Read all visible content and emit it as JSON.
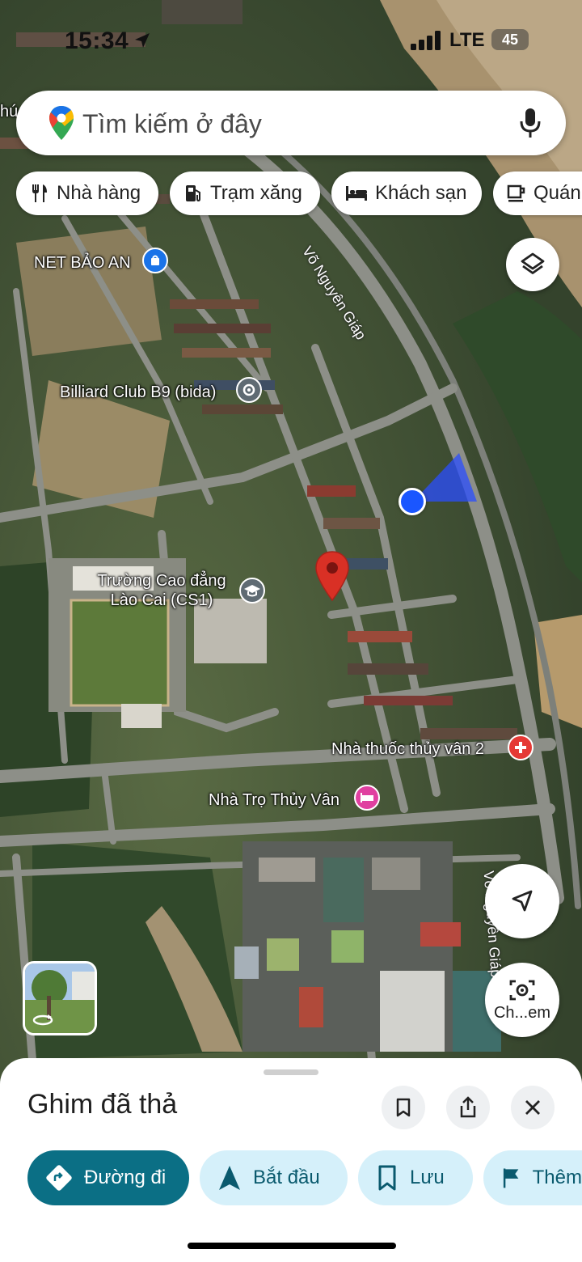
{
  "status_bar": {
    "time": "15:34",
    "network": "LTE",
    "battery": "45"
  },
  "search": {
    "placeholder": "Tìm kiếm ở đây"
  },
  "chips": [
    {
      "label": "Nhà hàng",
      "icon": "fork-knife-icon"
    },
    {
      "label": "Trạm xăng",
      "icon": "gas-pump-icon"
    },
    {
      "label": "Khách sạn",
      "icon": "bed-icon"
    },
    {
      "label": "Quán",
      "icon": "coffee-cup-icon"
    }
  ],
  "map": {
    "labels": {
      "net_bao_an": "NET BẢO AN",
      "billiard": "Billiard Club B9 (bida)",
      "college": "Trường Cao đẳng Lào Cai (CS1)",
      "pharmacy": "Nhà thuốc thủy vân 2",
      "guesthouse": "Nhà Trọ Thủy Vân",
      "edge_fragment": "hú"
    },
    "streets": {
      "top": "Võ Nguyên Giáp",
      "right": "Võ Nguyên Giáp"
    },
    "colors": {
      "pin": "#d93025",
      "location_dot": "#1a56ff",
      "poi_blue": "#1a73e8",
      "poi_gray": "#5f6b73",
      "poi_red": "#e53935",
      "poi_pink": "#e040a0"
    }
  },
  "buttons": {
    "explore_label": "Ch...em"
  },
  "sheet": {
    "title": "Ghim đã thả",
    "actions": [
      {
        "label": "Đường đi",
        "icon": "directions-icon"
      },
      {
        "label": "Bắt đầu",
        "icon": "navigation-arrow-icon"
      },
      {
        "label": "Lưu",
        "icon": "bookmark-icon"
      },
      {
        "label": "Thêm",
        "icon": "flag-icon"
      }
    ]
  }
}
